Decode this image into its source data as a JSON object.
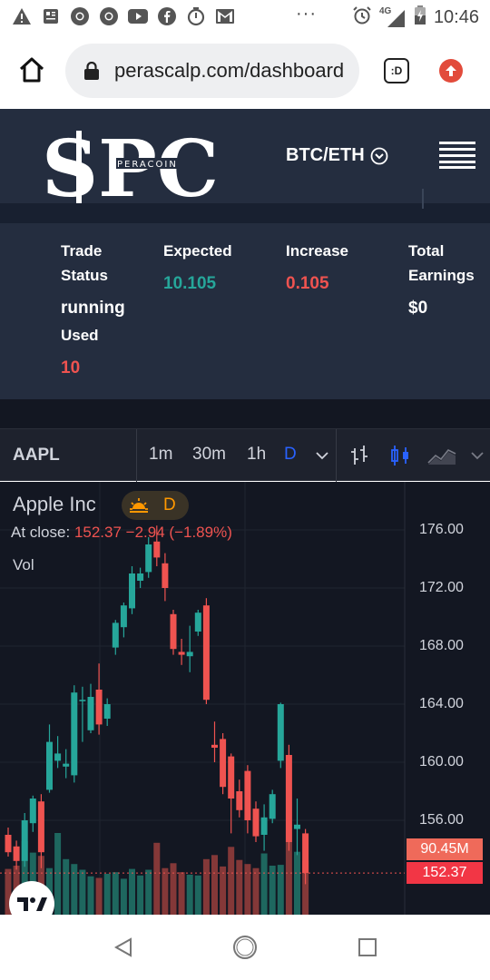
{
  "status_bar": {
    "time": "10:46",
    "network": "4G",
    "dots": "···",
    "icons": [
      "warning-icon",
      "news-icon",
      "chrome-icon",
      "chrome-icon",
      "youtube-icon",
      "facebook-icon",
      "timer-icon",
      "gmail-icon",
      "alarm-icon",
      "signal-icon",
      "battery-icon"
    ]
  },
  "browser": {
    "url": "perascalp.com/dashboard",
    "ext_label": ":D"
  },
  "header": {
    "logo_text": "SPC",
    "logo_subtext": "PERACOIN",
    "pair": "BTC/ETH"
  },
  "stats": {
    "trade_status_label_1": "Trade",
    "trade_status_label_2": "Status",
    "trade_status_value": "running",
    "used_label": "Used",
    "used_value": "10",
    "expected_label": "Expected",
    "expected_value": "10.105",
    "increase_label": "Increase",
    "increase_value": "0.105",
    "total_label_1": "Total",
    "total_label_2": "Earnings",
    "total_value": "$0"
  },
  "chart_toolbar": {
    "symbol": "AAPL",
    "intervals": [
      "1m",
      "30m",
      "1h",
      "D"
    ],
    "active_interval": "D"
  },
  "chart_legend": {
    "title": "Apple Inc",
    "period": "D",
    "close_label": "At close:",
    "close_value": "152.37",
    "change_value": "−2.94 (−1.89%)",
    "vol_label": "Vol"
  },
  "chart_data": {
    "type": "candlestick",
    "price_axis": [
      "176.00",
      "172.00",
      "168.00",
      "164.00",
      "160.00",
      "156.00"
    ],
    "ylim": [
      151.2,
      176.6
    ],
    "last_volume": "90.45M",
    "last_price": "152.37",
    "candles": [
      {
        "o": 155.0,
        "h": 155.5,
        "l": 153.5,
        "c": 153.8,
        "v": 0.56
      },
      {
        "o": 154.2,
        "h": 154.6,
        "l": 152.6,
        "c": 153.2,
        "v": 0.6
      },
      {
        "o": 153.2,
        "h": 156.5,
        "l": 152.8,
        "c": 156.0,
        "v": 0.9
      },
      {
        "o": 155.8,
        "h": 157.7,
        "l": 155.2,
        "c": 157.5,
        "v": 0.76
      },
      {
        "o": 157.3,
        "h": 157.8,
        "l": 152.7,
        "c": 153.8,
        "v": 0.72
      },
      {
        "o": 158.1,
        "h": 162.6,
        "l": 157.9,
        "c": 161.4,
        "v": 0.57
      },
      {
        "o": 160.1,
        "h": 161.8,
        "l": 159.6,
        "c": 160.6,
        "v": 1.0
      },
      {
        "o": 159.7,
        "h": 160.9,
        "l": 158.9,
        "c": 159.9,
        "v": 0.68
      },
      {
        "o": 159.1,
        "h": 165.3,
        "l": 158.6,
        "c": 164.8,
        "v": 0.62
      },
      {
        "o": 164.2,
        "h": 165.2,
        "l": 161.4,
        "c": 164.3,
        "v": 0.55
      },
      {
        "o": 162.2,
        "h": 165.4,
        "l": 162.0,
        "c": 164.5,
        "v": 0.47
      },
      {
        "o": 165.0,
        "h": 166.8,
        "l": 161.9,
        "c": 162.6,
        "v": 0.45
      },
      {
        "o": 163.0,
        "h": 164.4,
        "l": 162.5,
        "c": 164.0,
        "v": 0.5
      },
      {
        "o": 167.9,
        "h": 169.8,
        "l": 167.4,
        "c": 169.6,
        "v": 0.52
      },
      {
        "o": 169.3,
        "h": 171.0,
        "l": 168.6,
        "c": 170.8,
        "v": 0.44
      },
      {
        "o": 170.6,
        "h": 173.5,
        "l": 170.2,
        "c": 173.0,
        "v": 0.56
      },
      {
        "o": 172.5,
        "h": 173.4,
        "l": 172.0,
        "c": 173.0,
        "v": 0.48
      },
      {
        "o": 173.1,
        "h": 175.5,
        "l": 172.7,
        "c": 175.0,
        "v": 0.55
      },
      {
        "o": 175.2,
        "h": 176.3,
        "l": 173.5,
        "c": 174.1,
        "v": 0.88
      },
      {
        "o": 173.7,
        "h": 174.4,
        "l": 171.1,
        "c": 172.0,
        "v": 0.57
      },
      {
        "o": 170.2,
        "h": 170.5,
        "l": 167.4,
        "c": 167.8,
        "v": 0.63
      },
      {
        "o": 167.6,
        "h": 168.5,
        "l": 166.7,
        "c": 167.4,
        "v": 0.52
      },
      {
        "o": 167.3,
        "h": 169.4,
        "l": 166.2,
        "c": 167.6,
        "v": 0.49
      },
      {
        "o": 169.0,
        "h": 170.5,
        "l": 168.7,
        "c": 170.3,
        "v": 0.48
      },
      {
        "o": 170.8,
        "h": 171.3,
        "l": 164.0,
        "c": 164.3,
        "v": 0.68
      },
      {
        "o": 161.2,
        "h": 162.8,
        "l": 160.0,
        "c": 161.0,
        "v": 0.73
      },
      {
        "o": 161.6,
        "h": 162.0,
        "l": 157.8,
        "c": 158.3,
        "v": 0.59
      },
      {
        "o": 160.4,
        "h": 160.6,
        "l": 155.1,
        "c": 157.5,
        "v": 0.83
      },
      {
        "o": 158.0,
        "h": 158.8,
        "l": 156.2,
        "c": 156.7,
        "v": 0.67
      },
      {
        "o": 159.4,
        "h": 159.8,
        "l": 155.1,
        "c": 156.0,
        "v": 0.62
      },
      {
        "o": 156.8,
        "h": 157.3,
        "l": 154.5,
        "c": 154.9,
        "v": 0.57
      },
      {
        "o": 155.0,
        "h": 157.1,
        "l": 153.9,
        "c": 156.2,
        "v": 0.75
      },
      {
        "o": 156.1,
        "h": 158.1,
        "l": 155.8,
        "c": 157.8,
        "v": 0.6
      },
      {
        "o": 160.1,
        "h": 164.1,
        "l": 159.6,
        "c": 164.0,
        "v": 0.61
      },
      {
        "o": 160.5,
        "h": 161.2,
        "l": 153.9,
        "c": 154.5,
        "v": 0.89
      },
      {
        "o": 155.4,
        "h": 157.5,
        "l": 153.6,
        "c": 155.7,
        "v": 0.77
      },
      {
        "o": 155.1,
        "h": 155.4,
        "l": 151.6,
        "c": 152.37,
        "v": 0.66
      }
    ]
  }
}
